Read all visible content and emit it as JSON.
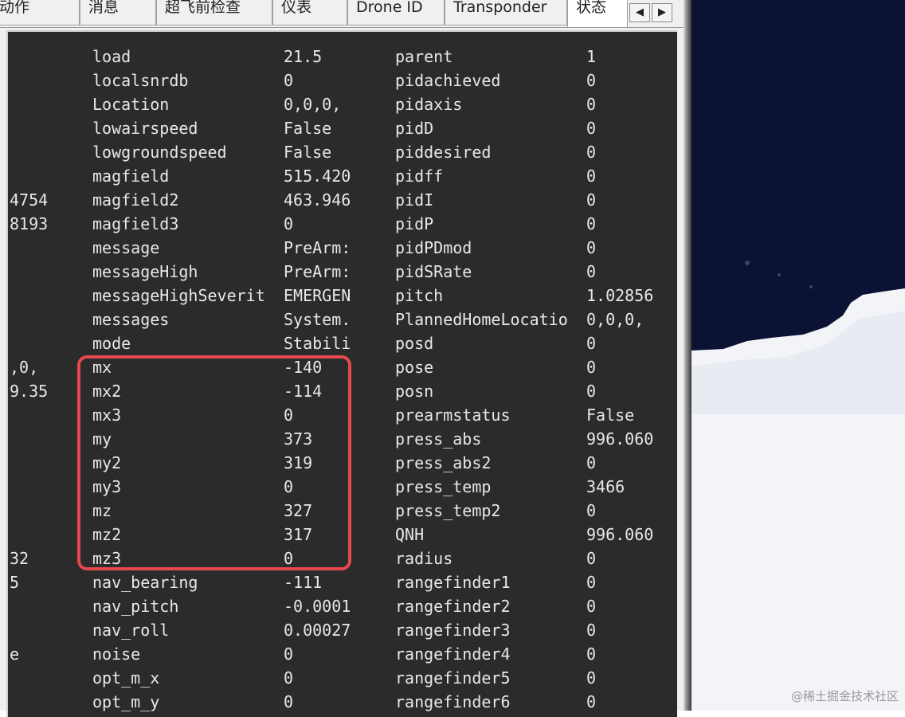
{
  "tabs": [
    "动作",
    "消息",
    "超飞前检查",
    "仪表",
    "Drone ID",
    "Transponder",
    "状态"
  ],
  "rows": [
    {
      "c0": "",
      "c1": "load",
      "c2": "21.5",
      "c3": "parent",
      "c4": "1"
    },
    {
      "c0": "",
      "c1": "localsnrdb",
      "c2": "0",
      "c3": "pidachieved",
      "c4": "0"
    },
    {
      "c0": "",
      "c1": "Location",
      "c2": "0,0,0,",
      "c3": "pidaxis",
      "c4": "0"
    },
    {
      "c0": "",
      "c1": "lowairspeed",
      "c2": "False",
      "c3": "pidD",
      "c4": "0"
    },
    {
      "c0": "",
      "c1": "lowgroundspeed",
      "c2": "False",
      "c3": "piddesired",
      "c4": "0"
    },
    {
      "c0": "",
      "c1": "magfield",
      "c2": "515.420",
      "c3": "pidff",
      "c4": "0"
    },
    {
      "c0": "4754",
      "c1": "magfield2",
      "c2": "463.946",
      "c3": "pidI",
      "c4": "0"
    },
    {
      "c0": "8193",
      "c1": "magfield3",
      "c2": "0",
      "c3": "pidP",
      "c4": "0"
    },
    {
      "c0": "",
      "c1": "message",
      "c2": "PreArm:",
      "c3": "pidPDmod",
      "c4": "0"
    },
    {
      "c0": "",
      "c1": "messageHigh",
      "c2": "PreArm:",
      "c3": "pidSRate",
      "c4": "0"
    },
    {
      "c0": "",
      "c1": "messageHighSeverit",
      "c2": "EMERGEN",
      "c3": "pitch",
      "c4": "1.02856"
    },
    {
      "c0": "",
      "c1": "messages",
      "c2": "System.",
      "c3": "PlannedHomeLocatio",
      "c4": "0,0,0,"
    },
    {
      "c0": "",
      "c1": "mode",
      "c2": "Stabili",
      "c3": "posd",
      "c4": "0"
    },
    {
      "c0": ",0,",
      "c1": "mx",
      "c2": "-140",
      "c3": "pose",
      "c4": "0"
    },
    {
      "c0": "9.35",
      "c1": "mx2",
      "c2": "-114",
      "c3": "posn",
      "c4": "0"
    },
    {
      "c0": "",
      "c1": "mx3",
      "c2": "0",
      "c3": "prearmstatus",
      "c4": "False"
    },
    {
      "c0": "",
      "c1": "my",
      "c2": "373",
      "c3": "press_abs",
      "c4": "996.060"
    },
    {
      "c0": "",
      "c1": "my2",
      "c2": "319",
      "c3": "press_abs2",
      "c4": "0"
    },
    {
      "c0": "",
      "c1": "my3",
      "c2": "0",
      "c3": "press_temp",
      "c4": "3466"
    },
    {
      "c0": "",
      "c1": "mz",
      "c2": "327",
      "c3": "press_temp2",
      "c4": "0"
    },
    {
      "c0": "",
      "c1": "mz2",
      "c2": "317",
      "c3": "QNH",
      "c4": "996.060"
    },
    {
      "c0": "32",
      "c1": "mz3",
      "c2": "0",
      "c3": "radius",
      "c4": "0"
    },
    {
      "c0": "5",
      "c1": "nav_bearing",
      "c2": "-111",
      "c3": "rangefinder1",
      "c4": "0"
    },
    {
      "c0": "",
      "c1": "nav_pitch",
      "c2": "-0.0001",
      "c3": "rangefinder2",
      "c4": "0"
    },
    {
      "c0": "",
      "c1": "nav_roll",
      "c2": "0.00027",
      "c3": "rangefinder3",
      "c4": "0"
    },
    {
      "c0": "e",
      "c1": "noise",
      "c2": "0",
      "c3": "rangefinder4",
      "c4": "0"
    },
    {
      "c0": "",
      "c1": "opt_m_x",
      "c2": "0",
      "c3": "rangefinder5",
      "c4": "0"
    },
    {
      "c0": "",
      "c1": "opt_m_y",
      "c2": "0",
      "c3": "rangefinder6",
      "c4": "0"
    }
  ],
  "scroll_left": "◀",
  "scroll_right": "▶",
  "watermark": "@稀土掘金技术社区",
  "colors": {
    "panel_bg": "#2b2b2b",
    "text": "#e8e8e8",
    "highlight": "#e5484d",
    "sky": "#0b1233"
  }
}
